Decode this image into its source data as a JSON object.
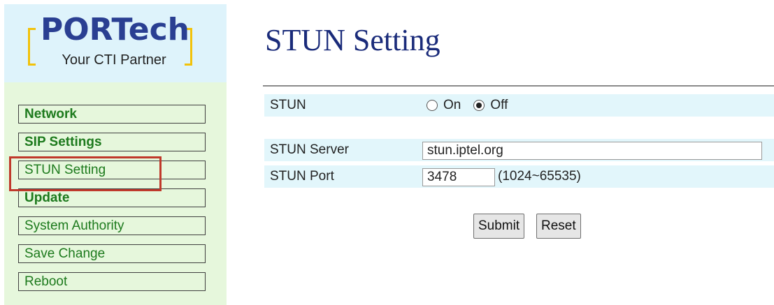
{
  "logo": {
    "brand": "PORTech",
    "tagline": "Your CTI Partner"
  },
  "sidebar": {
    "items": [
      {
        "label": "Network"
      },
      {
        "label": "SIP Settings"
      },
      {
        "label": "STUN Setting"
      },
      {
        "label": "Update"
      },
      {
        "label": "System Authority"
      },
      {
        "label": "Save Change"
      },
      {
        "label": "Reboot"
      }
    ],
    "highlighted": "STUN Setting"
  },
  "page": {
    "title": "STUN Setting"
  },
  "form": {
    "stun_label": "STUN",
    "stun_options": [
      {
        "label": "On",
        "selected": false
      },
      {
        "label": "Off",
        "selected": true
      }
    ],
    "server_label": "STUN Server",
    "server_value": "stun.iptel.org",
    "port_label": "STUN Port",
    "port_value": "3478",
    "port_range": "(1024~65535)"
  },
  "buttons": {
    "submit": "Submit",
    "reset": "Reset"
  },
  "colors": {
    "highlight_border": "#c0392b",
    "menu_text": "#1d7a1d",
    "title_text": "#1a2b7a",
    "row_bg": "#e2f6fb",
    "menu_bg": "#e6f7dc",
    "logo_bg": "#def3fb"
  }
}
